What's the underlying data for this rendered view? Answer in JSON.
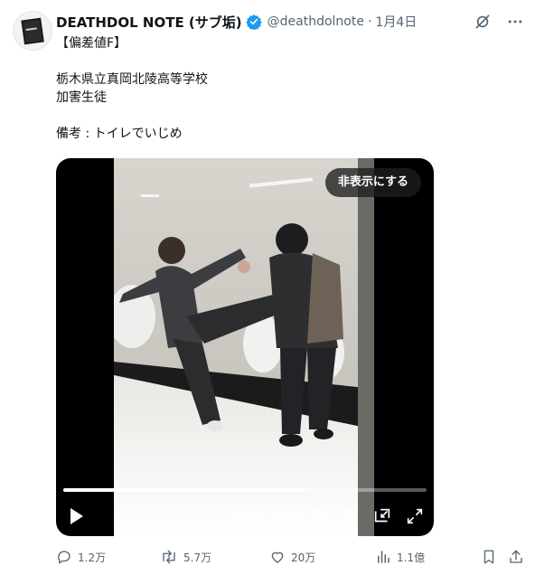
{
  "tweet": {
    "author_name": "DEATHDOL NOTE (サブ垢)",
    "handle": "@deathdolnote",
    "separator": "·",
    "date": "1月4日",
    "lines": [
      "【偏差値F】",
      "",
      "栃木県立真岡北陵高等学校",
      "加害生徒",
      "",
      "備考 : トイレでいじめ"
    ]
  },
  "video": {
    "hide_label": "非表示にする",
    "time_label": "0:06 / 0:09",
    "progress_fraction": 0.667
  },
  "stats": {
    "replies": "1.2万",
    "retweets": "5.7万",
    "likes": "20万",
    "views": "1.1億"
  },
  "colors": {
    "text": "#0f1419",
    "secondary": "#536471",
    "verified": "#1d9bf0"
  },
  "icons": [
    "grok-icon",
    "more-icon",
    "play-icon",
    "volume-icon",
    "settings-icon",
    "pip-icon",
    "fullscreen-icon",
    "reply-icon",
    "retweet-icon",
    "like-icon",
    "views-icon",
    "bookmark-icon",
    "share-icon",
    "verified-icon"
  ]
}
